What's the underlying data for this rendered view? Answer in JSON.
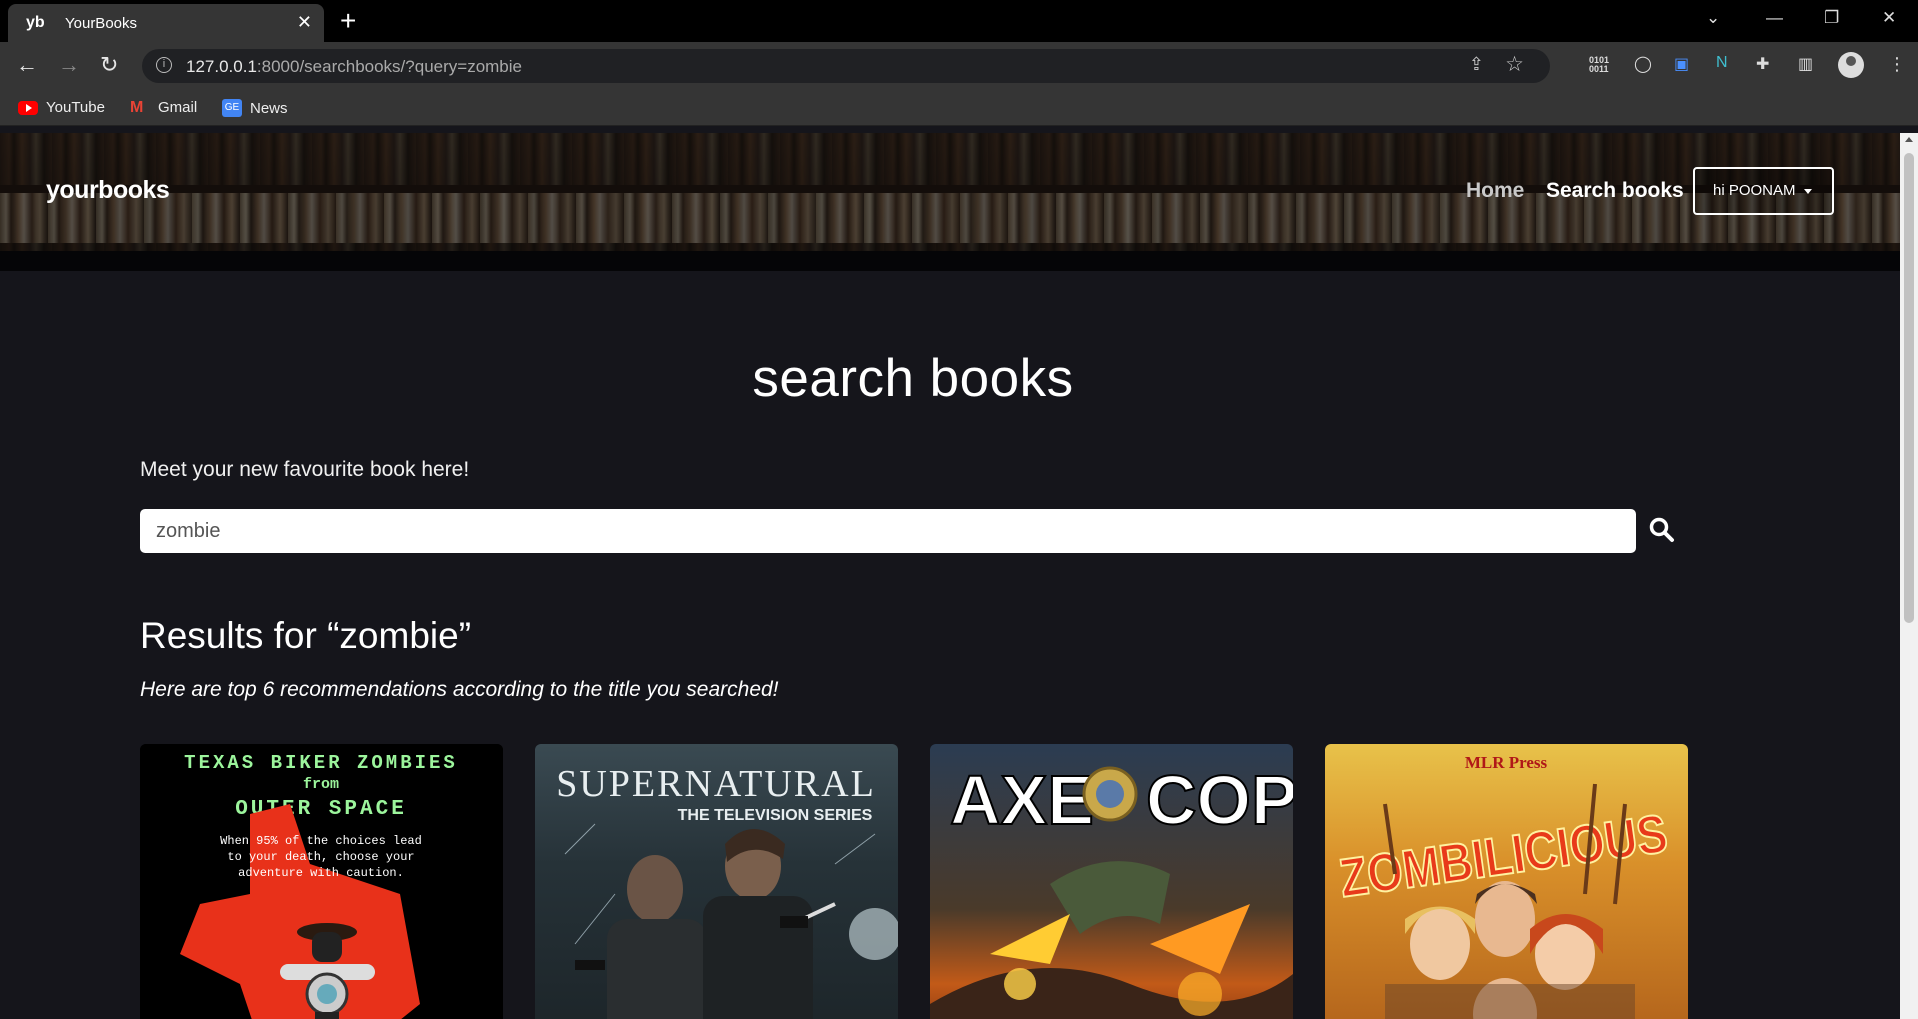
{
  "browser": {
    "tab_favicon": "yb",
    "tab_title": "YourBooks",
    "url_host": "127.0.0.1",
    "url_rest": ":8000/searchbooks/?query=zombie",
    "bookmarks": [
      {
        "label": "YouTube",
        "icon": "youtube-icon"
      },
      {
        "label": "Gmail",
        "icon": "gmail-icon"
      },
      {
        "label": "News",
        "icon": "news-icon"
      }
    ]
  },
  "header": {
    "brand": "yourbooks",
    "nav": {
      "home": "Home",
      "search": "Search books"
    },
    "user_button": "hi POONAM"
  },
  "main": {
    "title": "search books",
    "tagline": "Meet your new favourite book here!",
    "search_value": "zombie",
    "results_title": "Results for “zombie”",
    "results_subtitle": "Here are top 6 recommendations according to the title you searched!"
  },
  "books": [
    {
      "cover_line1": "TEXAS BIKER ZOMBIES",
      "cover_line2": "from",
      "cover_line3": "OUTER SPACE",
      "cover_blurb1": "When 95% of the choices lead",
      "cover_blurb2": "to your death, choose your",
      "cover_blurb3": "adventure with caution."
    },
    {
      "cover_line1": "SUPERNATURAL",
      "cover_line2": "THE TELEVISION SERIES"
    },
    {
      "cover_line1": "AXE",
      "cover_line2": "COP"
    },
    {
      "cover_line1": "MLR Press",
      "cover_line2": "ZOMBILICIOUS"
    }
  ],
  "colors": {
    "page_bg": "#15151b",
    "accent_green": "#7ef07e",
    "accent_red": "#e8311a"
  }
}
